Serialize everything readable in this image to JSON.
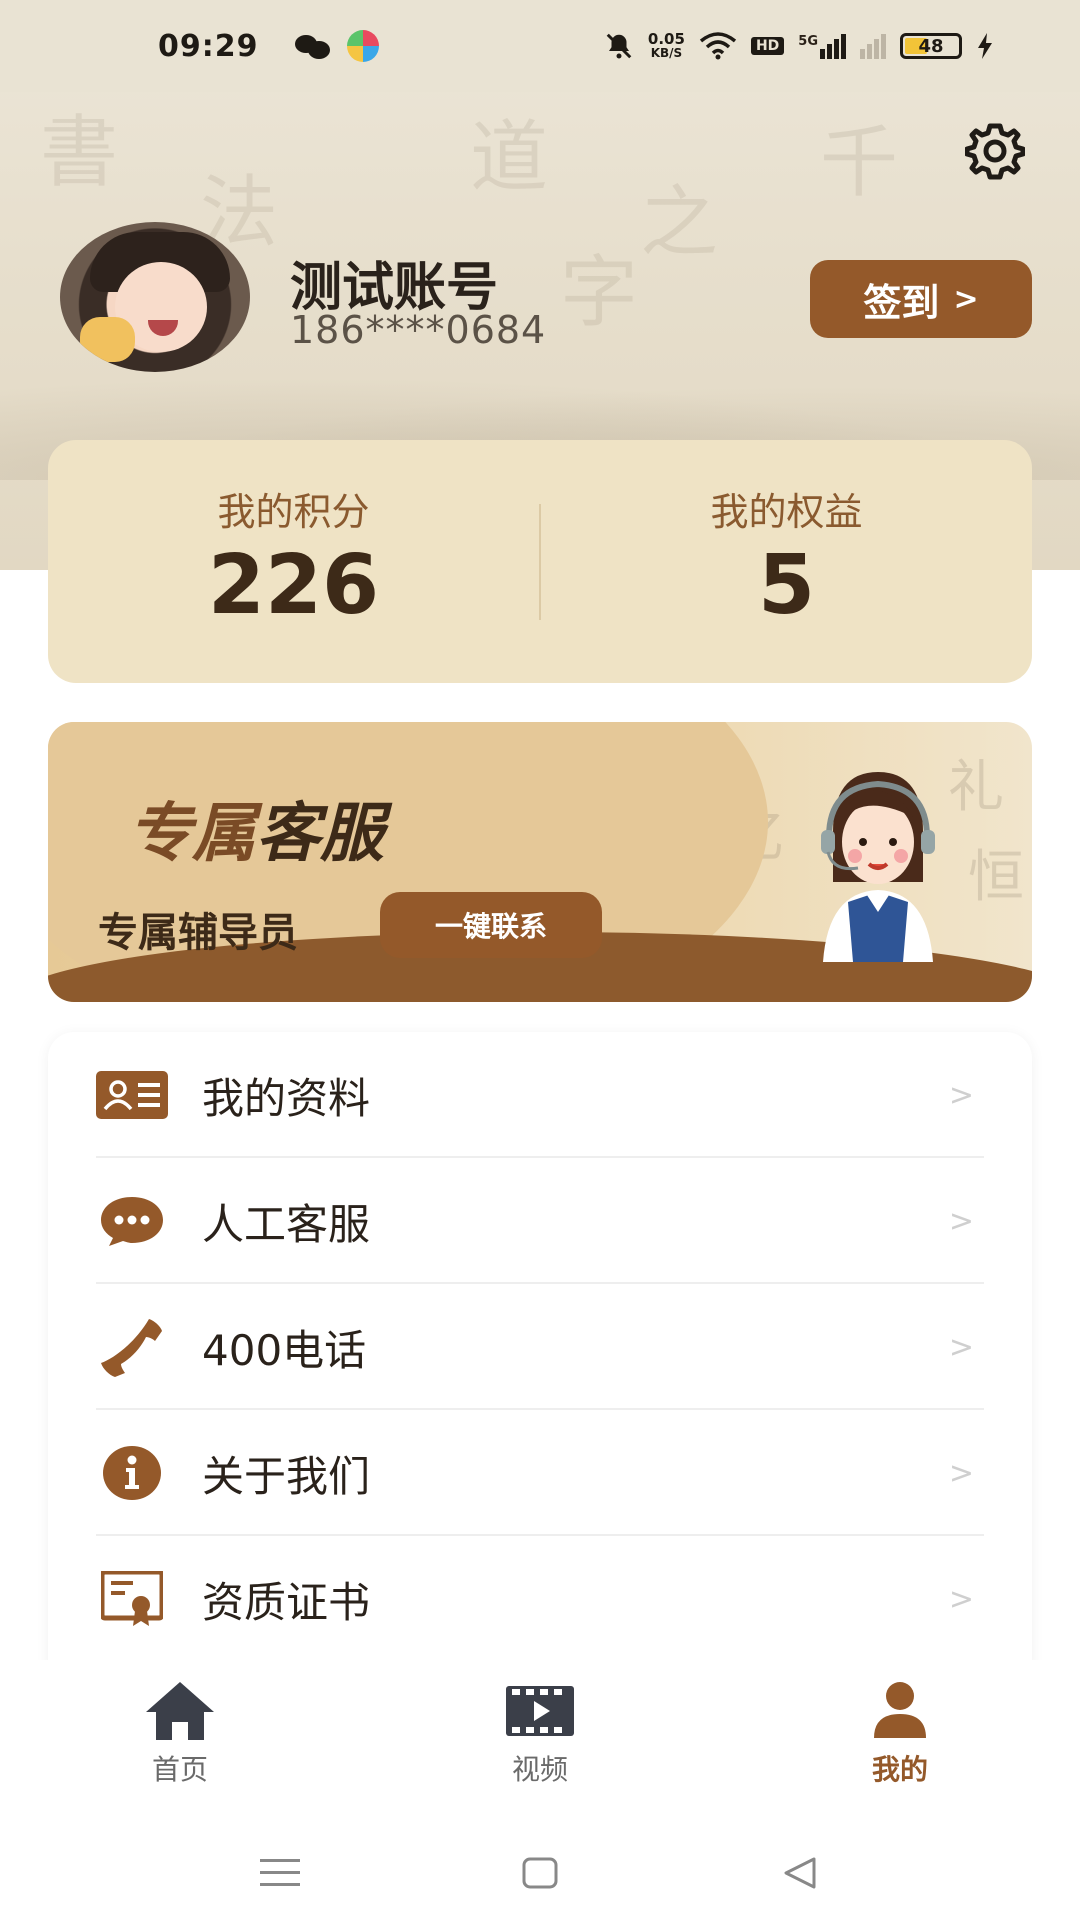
{
  "status_bar": {
    "time": "09:29",
    "net_speed_value": "0.05",
    "net_speed_unit": "KB/S",
    "hd": "HD",
    "signal": "5G",
    "battery": "48"
  },
  "profile": {
    "name": "测试账号",
    "phone": "186****0684",
    "signin_label": "签到",
    "signin_arrow": ">"
  },
  "stats": {
    "points_label": "我的积分",
    "points_value": "226",
    "benefits_label": "我的权益",
    "benefits_value": "5"
  },
  "banner": {
    "title_part1": "专属",
    "title_part2": "客服",
    "subtitle": "专属辅导员",
    "contact_label": "一键联系"
  },
  "menu": {
    "items": [
      {
        "label": "我的资料",
        "icon": "id-card-icon"
      },
      {
        "label": "人工客服",
        "icon": "chat-bubble-icon"
      },
      {
        "label": "400电话",
        "icon": "phone-icon"
      },
      {
        "label": "关于我们",
        "icon": "info-icon"
      },
      {
        "label": "资质证书",
        "icon": "certificate-icon"
      }
    ],
    "arrow": ">"
  },
  "tabs": [
    {
      "label": "首页",
      "icon": "home-icon"
    },
    {
      "label": "视频",
      "icon": "video-icon"
    },
    {
      "label": "我的",
      "icon": "user-icon",
      "active": true
    }
  ],
  "colors": {
    "accent": "#94592a",
    "card_bg": "#efe3c5",
    "text_dark": "#2a221b"
  }
}
